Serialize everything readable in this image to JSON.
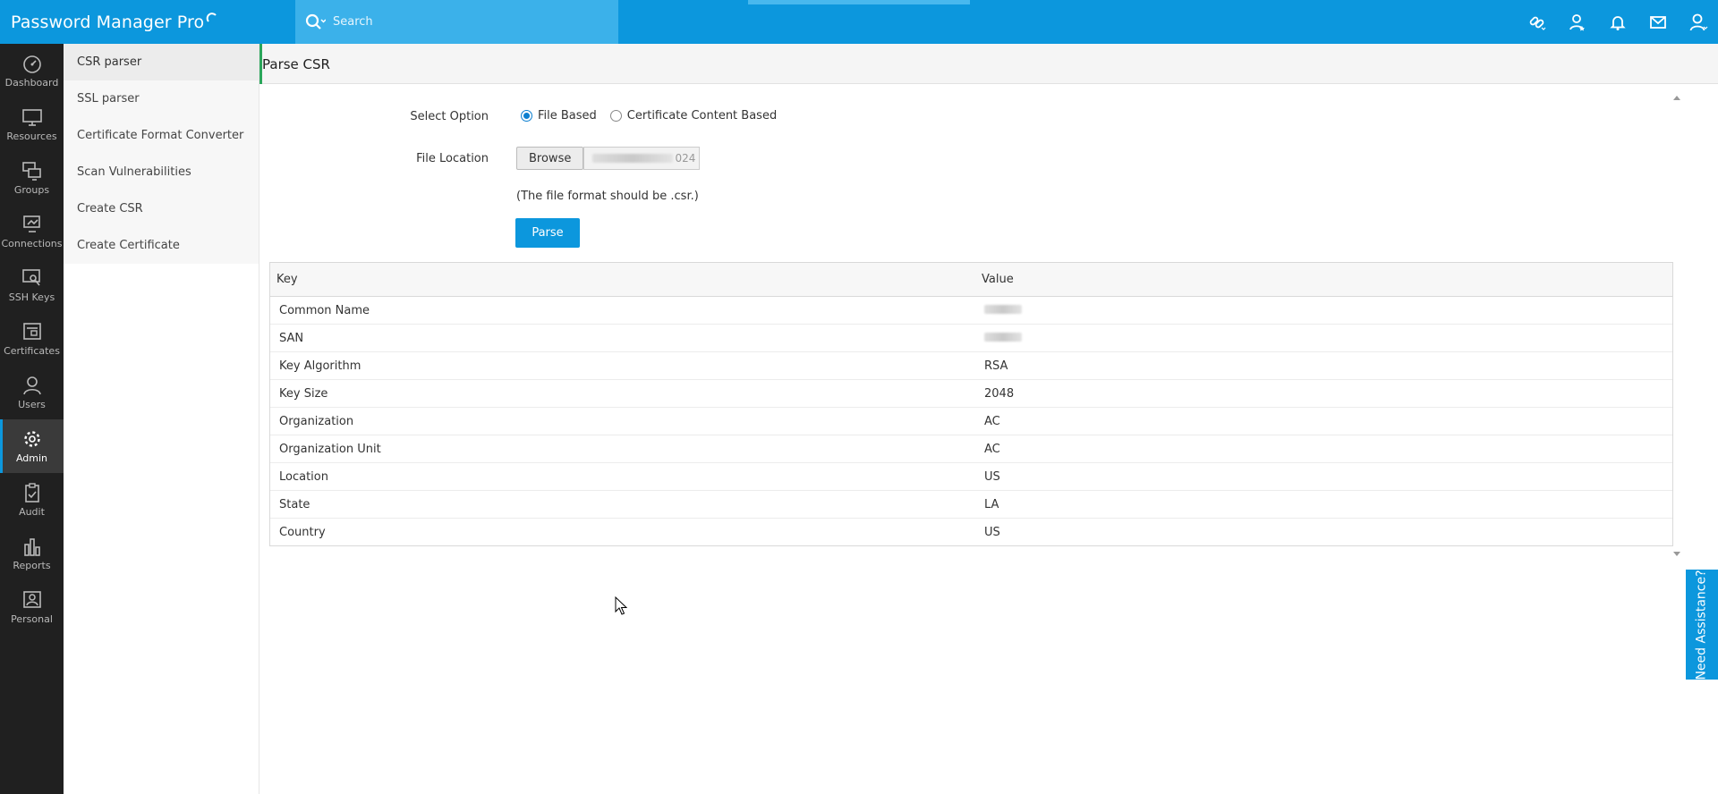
{
  "app": {
    "brand": "Password Manager Pro"
  },
  "search": {
    "placeholder": "Search"
  },
  "rail": {
    "items": [
      {
        "label": "Dashboard",
        "icon": "dashboard-icon"
      },
      {
        "label": "Resources",
        "icon": "monitor-icon"
      },
      {
        "label": "Groups",
        "icon": "groups-icon"
      },
      {
        "label": "Connections",
        "icon": "connections-icon"
      },
      {
        "label": "SSH Keys",
        "icon": "ssh-key-icon"
      },
      {
        "label": "Certificates",
        "icon": "certificate-icon"
      },
      {
        "label": "Users",
        "icon": "user-icon"
      },
      {
        "label": "Admin",
        "icon": "gear-icon",
        "active": true
      },
      {
        "label": "Audit",
        "icon": "clipboard-icon"
      },
      {
        "label": "Reports",
        "icon": "bar-chart-icon"
      },
      {
        "label": "Personal",
        "icon": "personal-icon"
      }
    ]
  },
  "submenu": {
    "items": [
      {
        "label": "CSR parser",
        "active": true
      },
      {
        "label": "SSL parser"
      },
      {
        "label": "Certificate Format Converter"
      },
      {
        "label": "Scan Vulnerabilities"
      },
      {
        "label": "Create CSR"
      },
      {
        "label": "Create Certificate"
      }
    ]
  },
  "page": {
    "title": "Parse CSR"
  },
  "form": {
    "select_option_label": "Select Option",
    "option_file": "File Based",
    "option_content": "Certificate Content Based",
    "selected": "File Based",
    "file_location_label": "File Location",
    "browse_label": "Browse",
    "file_value_visible": "024",
    "hint": "(The file format should be .csr.)",
    "parse_label": "Parse"
  },
  "table": {
    "headers": [
      "Key",
      "Value"
    ],
    "rows": [
      {
        "key": "Common Name",
        "value": ""
      },
      {
        "key": "SAN",
        "value": ""
      },
      {
        "key": "Key Algorithm",
        "value": "RSA"
      },
      {
        "key": "Key Size",
        "value": "2048"
      },
      {
        "key": "Organization",
        "value": "AC"
      },
      {
        "key": "Organization Unit",
        "value": "AC"
      },
      {
        "key": "Location",
        "value": "US"
      },
      {
        "key": "State",
        "value": "LA"
      },
      {
        "key": "Country",
        "value": "US"
      }
    ]
  },
  "help": {
    "label": "Need Assistance?"
  },
  "colors": {
    "accent": "#0c97dd",
    "rail": "#202020",
    "header_bar": "#2aa65a"
  }
}
